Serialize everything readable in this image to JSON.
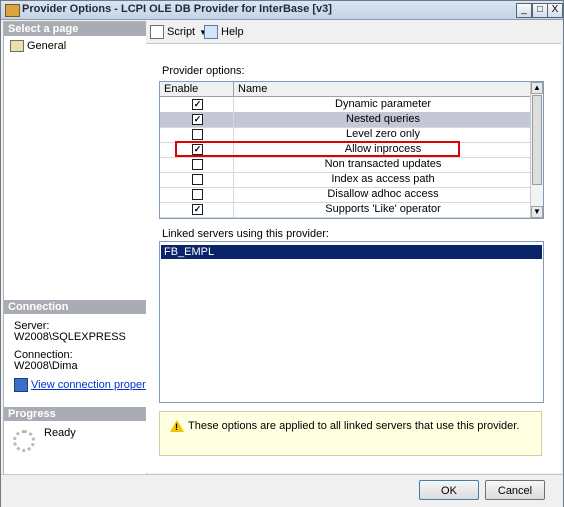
{
  "window": {
    "title": "Provider Options - LCPI OLE DB Provider for InterBase [v3]",
    "buttons": {
      "minimize": "_",
      "maximize": "□",
      "close": "X"
    }
  },
  "left": {
    "select_page": "Select a page",
    "pages": [
      {
        "label": "General"
      }
    ],
    "connection": {
      "header": "Connection",
      "server_label": "Server:",
      "server_value": "W2008\\SQLEXPRESS",
      "connection_label": "Connection:",
      "connection_value": "W2008\\Dima",
      "view_link": "View connection properties"
    },
    "progress": {
      "header": "Progress",
      "status": "Ready"
    }
  },
  "toolbar": {
    "script_label": "Script",
    "help_label": "Help"
  },
  "main": {
    "provider_options_label": "Provider options:",
    "columns": {
      "enable": "Enable",
      "name": "Name"
    },
    "options": [
      {
        "name": "Dynamic parameter",
        "checked": true
      },
      {
        "name": "Nested queries",
        "checked": true,
        "selected": true
      },
      {
        "name": "Level zero only",
        "checked": false
      },
      {
        "name": "Allow inprocess",
        "checked": true,
        "highlighted": true
      },
      {
        "name": "Non transacted updates",
        "checked": false
      },
      {
        "name": "Index as access path",
        "checked": false
      },
      {
        "name": "Disallow adhoc access",
        "checked": false
      },
      {
        "name": "Supports 'Like' operator",
        "checked": true
      }
    ],
    "linked_label": "Linked servers using this provider:",
    "linked_servers": [
      "FB_EMPL"
    ],
    "info_message": "These options are applied to all linked servers that use this provider."
  },
  "buttons": {
    "ok": "OK",
    "cancel": "Cancel"
  },
  "colors": {
    "selection": "#0a246a",
    "highlight_border": "#e00000",
    "info_bg": "#ffffe1"
  }
}
